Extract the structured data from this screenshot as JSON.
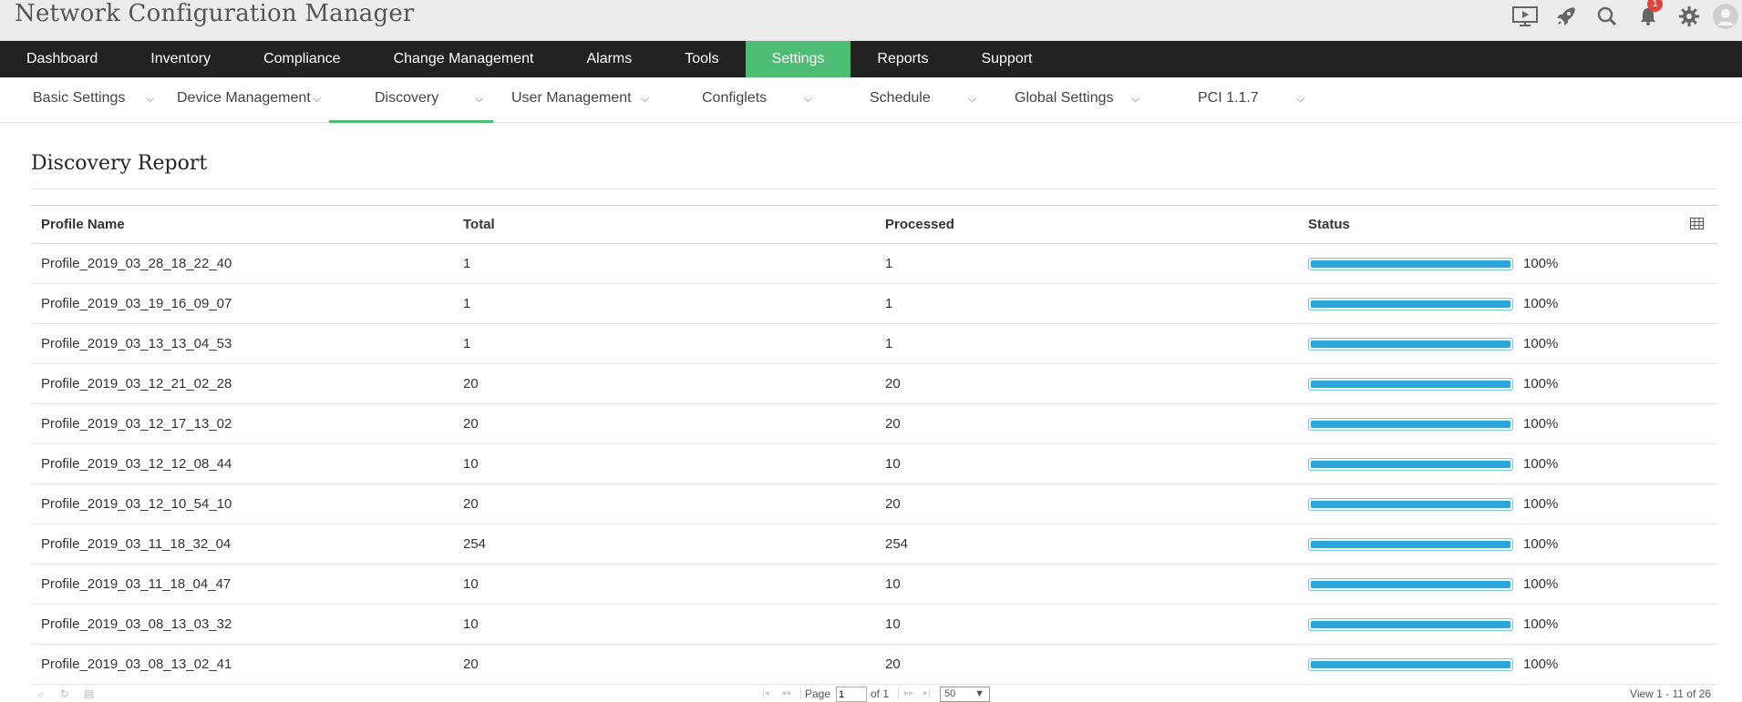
{
  "app": {
    "title": "Network Configuration Manager"
  },
  "header": {
    "icons": [
      "presentation-icon",
      "rocket-icon",
      "search-icon",
      "bell-icon",
      "gear-icon",
      "user-avatar-icon"
    ],
    "notification_count": "1"
  },
  "main_nav": {
    "items": [
      {
        "label": "Dashboard"
      },
      {
        "label": "Inventory"
      },
      {
        "label": "Compliance"
      },
      {
        "label": "Change Management"
      },
      {
        "label": "Alarms"
      },
      {
        "label": "Tools"
      },
      {
        "label": "Settings"
      },
      {
        "label": "Reports"
      },
      {
        "label": "Support"
      }
    ],
    "active": "Settings",
    "active_color": "#4dbd74"
  },
  "sub_nav": {
    "items": [
      {
        "label": "Basic Settings"
      },
      {
        "label": "Device Management"
      },
      {
        "label": "Discovery"
      },
      {
        "label": "User Management"
      },
      {
        "label": "Configlets"
      },
      {
        "label": "Schedule"
      },
      {
        "label": "Global Settings"
      },
      {
        "label": "PCI 1.1.7"
      }
    ],
    "active": "Discovery",
    "chevron_glyph": "⌵"
  },
  "report": {
    "title": "Discovery Report",
    "columns": [
      "Profile Name",
      "Total",
      "Processed",
      "Status"
    ],
    "rows": [
      {
        "profile": "Profile_2019_03_28_18_22_40",
        "total": "1",
        "processed": "1",
        "status": "100%",
        "progress": 1.0
      },
      {
        "profile": "Profile_2019_03_19_16_09_07",
        "total": "1",
        "processed": "1",
        "status": "100%",
        "progress": 1.0
      },
      {
        "profile": "Profile_2019_03_13_13_04_53",
        "total": "1",
        "processed": "1",
        "status": "100%",
        "progress": 1.0
      },
      {
        "profile": "Profile_2019_03_12_21_02_28",
        "total": "20",
        "processed": "20",
        "status": "100%",
        "progress": 1.0
      },
      {
        "profile": "Profile_2019_03_12_17_13_02",
        "total": "20",
        "processed": "20",
        "status": "100%",
        "progress": 1.0
      },
      {
        "profile": "Profile_2019_03_12_12_08_44",
        "total": "10",
        "processed": "10",
        "status": "100%",
        "progress": 1.0
      },
      {
        "profile": "Profile_2019_03_12_10_54_10",
        "total": "20",
        "processed": "20",
        "status": "100%",
        "progress": 1.0
      },
      {
        "profile": "Profile_2019_03_11_18_32_04",
        "total": "254",
        "processed": "254",
        "status": "100%",
        "progress": 1.0
      },
      {
        "profile": "Profile_2019_03_11_18_04_47",
        "total": "10",
        "processed": "10",
        "status": "100%",
        "progress": 1.0
      },
      {
        "profile": "Profile_2019_03_08_13_03_32",
        "total": "10",
        "processed": "10",
        "status": "100%",
        "progress": 1.0
      },
      {
        "profile": "Profile_2019_03_08_13_02_41",
        "total": "20",
        "processed": "20",
        "status": "100%",
        "progress": 1.0
      }
    ]
  },
  "pager": {
    "page_label": "Page",
    "page_value": "1",
    "of_label": "of 1",
    "page_size": "50",
    "view_label": "View 1 - 11 of 26"
  }
}
